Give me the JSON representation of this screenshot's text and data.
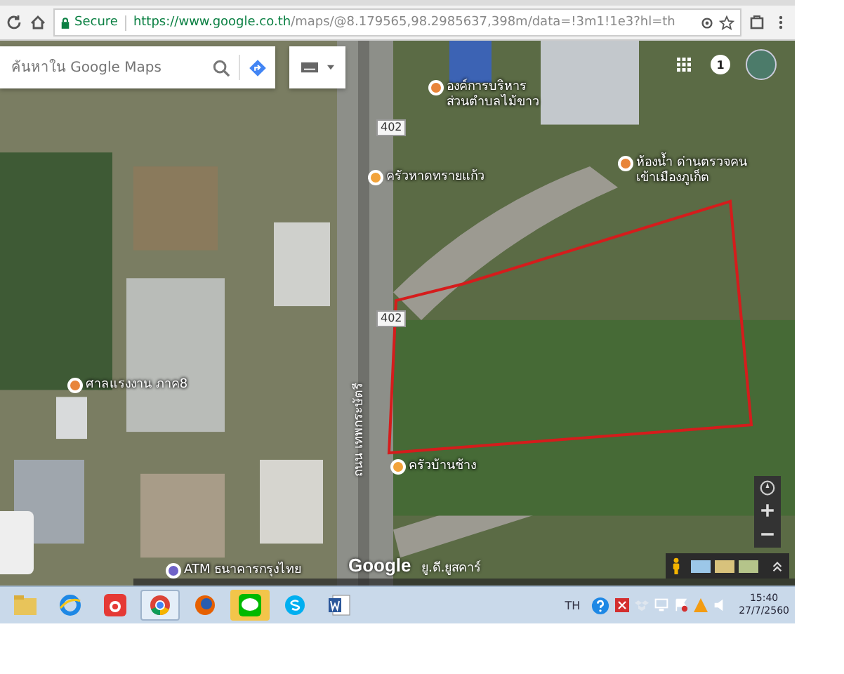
{
  "browser": {
    "security_label": "Secure",
    "url_host": "https://www.google.co.th",
    "url_path": "/maps/@8.179565,98.2985637,398m/data=!3m1!1e3?hl=th"
  },
  "search": {
    "placeholder": "ค้นหาใน Google Maps"
  },
  "account": {
    "notification_count": "1"
  },
  "map_labels": [
    {
      "text": "องค์การบริหารส่วนตำบลไม้ขาว"
    },
    {
      "text": "ครัวหาดทรายแก้ว"
    },
    {
      "text": "ห้องน้ำ ด่านตรวจคนเข้าเมืองภูเก็ต"
    },
    {
      "text": "ศาลแรงงาน ภาค8"
    },
    {
      "text": "ครัวบ้านช้าง"
    },
    {
      "text": "ATM ธนาคารกรุงไทย"
    }
  ],
  "road_signs": [
    "402",
    "402"
  ],
  "street_name": "ถนน เทพกระษัตรี",
  "google_logo": "Google",
  "logo_caption": "ยู.ดี.ยูสคาร์",
  "taskbar": {
    "language": "TH",
    "time": "15:40",
    "date": "27/7/2560"
  }
}
